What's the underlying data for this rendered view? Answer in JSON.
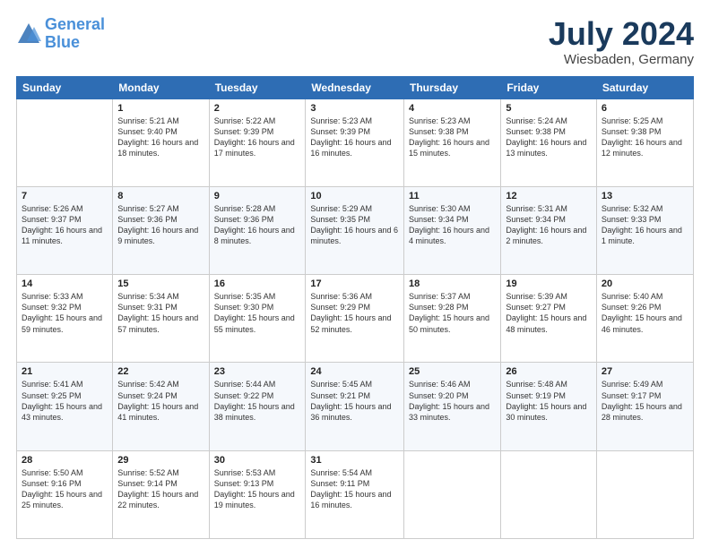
{
  "logo": {
    "line1": "General",
    "line2": "Blue"
  },
  "title": "July 2024",
  "location": "Wiesbaden, Germany",
  "headers": [
    "Sunday",
    "Monday",
    "Tuesday",
    "Wednesday",
    "Thursday",
    "Friday",
    "Saturday"
  ],
  "weeks": [
    [
      {
        "date": "",
        "sunrise": "",
        "sunset": "",
        "daylight": ""
      },
      {
        "date": "1",
        "sunrise": "Sunrise: 5:21 AM",
        "sunset": "Sunset: 9:40 PM",
        "daylight": "Daylight: 16 hours and 18 minutes."
      },
      {
        "date": "2",
        "sunrise": "Sunrise: 5:22 AM",
        "sunset": "Sunset: 9:39 PM",
        "daylight": "Daylight: 16 hours and 17 minutes."
      },
      {
        "date": "3",
        "sunrise": "Sunrise: 5:23 AM",
        "sunset": "Sunset: 9:39 PM",
        "daylight": "Daylight: 16 hours and 16 minutes."
      },
      {
        "date": "4",
        "sunrise": "Sunrise: 5:23 AM",
        "sunset": "Sunset: 9:38 PM",
        "daylight": "Daylight: 16 hours and 15 minutes."
      },
      {
        "date": "5",
        "sunrise": "Sunrise: 5:24 AM",
        "sunset": "Sunset: 9:38 PM",
        "daylight": "Daylight: 16 hours and 13 minutes."
      },
      {
        "date": "6",
        "sunrise": "Sunrise: 5:25 AM",
        "sunset": "Sunset: 9:38 PM",
        "daylight": "Daylight: 16 hours and 12 minutes."
      }
    ],
    [
      {
        "date": "7",
        "sunrise": "Sunrise: 5:26 AM",
        "sunset": "Sunset: 9:37 PM",
        "daylight": "Daylight: 16 hours and 11 minutes."
      },
      {
        "date": "8",
        "sunrise": "Sunrise: 5:27 AM",
        "sunset": "Sunset: 9:36 PM",
        "daylight": "Daylight: 16 hours and 9 minutes."
      },
      {
        "date": "9",
        "sunrise": "Sunrise: 5:28 AM",
        "sunset": "Sunset: 9:36 PM",
        "daylight": "Daylight: 16 hours and 8 minutes."
      },
      {
        "date": "10",
        "sunrise": "Sunrise: 5:29 AM",
        "sunset": "Sunset: 9:35 PM",
        "daylight": "Daylight: 16 hours and 6 minutes."
      },
      {
        "date": "11",
        "sunrise": "Sunrise: 5:30 AM",
        "sunset": "Sunset: 9:34 PM",
        "daylight": "Daylight: 16 hours and 4 minutes."
      },
      {
        "date": "12",
        "sunrise": "Sunrise: 5:31 AM",
        "sunset": "Sunset: 9:34 PM",
        "daylight": "Daylight: 16 hours and 2 minutes."
      },
      {
        "date": "13",
        "sunrise": "Sunrise: 5:32 AM",
        "sunset": "Sunset: 9:33 PM",
        "daylight": "Daylight: 16 hours and 1 minute."
      }
    ],
    [
      {
        "date": "14",
        "sunrise": "Sunrise: 5:33 AM",
        "sunset": "Sunset: 9:32 PM",
        "daylight": "Daylight: 15 hours and 59 minutes."
      },
      {
        "date": "15",
        "sunrise": "Sunrise: 5:34 AM",
        "sunset": "Sunset: 9:31 PM",
        "daylight": "Daylight: 15 hours and 57 minutes."
      },
      {
        "date": "16",
        "sunrise": "Sunrise: 5:35 AM",
        "sunset": "Sunset: 9:30 PM",
        "daylight": "Daylight: 15 hours and 55 minutes."
      },
      {
        "date": "17",
        "sunrise": "Sunrise: 5:36 AM",
        "sunset": "Sunset: 9:29 PM",
        "daylight": "Daylight: 15 hours and 52 minutes."
      },
      {
        "date": "18",
        "sunrise": "Sunrise: 5:37 AM",
        "sunset": "Sunset: 9:28 PM",
        "daylight": "Daylight: 15 hours and 50 minutes."
      },
      {
        "date": "19",
        "sunrise": "Sunrise: 5:39 AM",
        "sunset": "Sunset: 9:27 PM",
        "daylight": "Daylight: 15 hours and 48 minutes."
      },
      {
        "date": "20",
        "sunrise": "Sunrise: 5:40 AM",
        "sunset": "Sunset: 9:26 PM",
        "daylight": "Daylight: 15 hours and 46 minutes."
      }
    ],
    [
      {
        "date": "21",
        "sunrise": "Sunrise: 5:41 AM",
        "sunset": "Sunset: 9:25 PM",
        "daylight": "Daylight: 15 hours and 43 minutes."
      },
      {
        "date": "22",
        "sunrise": "Sunrise: 5:42 AM",
        "sunset": "Sunset: 9:24 PM",
        "daylight": "Daylight: 15 hours and 41 minutes."
      },
      {
        "date": "23",
        "sunrise": "Sunrise: 5:44 AM",
        "sunset": "Sunset: 9:22 PM",
        "daylight": "Daylight: 15 hours and 38 minutes."
      },
      {
        "date": "24",
        "sunrise": "Sunrise: 5:45 AM",
        "sunset": "Sunset: 9:21 PM",
        "daylight": "Daylight: 15 hours and 36 minutes."
      },
      {
        "date": "25",
        "sunrise": "Sunrise: 5:46 AM",
        "sunset": "Sunset: 9:20 PM",
        "daylight": "Daylight: 15 hours and 33 minutes."
      },
      {
        "date": "26",
        "sunrise": "Sunrise: 5:48 AM",
        "sunset": "Sunset: 9:19 PM",
        "daylight": "Daylight: 15 hours and 30 minutes."
      },
      {
        "date": "27",
        "sunrise": "Sunrise: 5:49 AM",
        "sunset": "Sunset: 9:17 PM",
        "daylight": "Daylight: 15 hours and 28 minutes."
      }
    ],
    [
      {
        "date": "28",
        "sunrise": "Sunrise: 5:50 AM",
        "sunset": "Sunset: 9:16 PM",
        "daylight": "Daylight: 15 hours and 25 minutes."
      },
      {
        "date": "29",
        "sunrise": "Sunrise: 5:52 AM",
        "sunset": "Sunset: 9:14 PM",
        "daylight": "Daylight: 15 hours and 22 minutes."
      },
      {
        "date": "30",
        "sunrise": "Sunrise: 5:53 AM",
        "sunset": "Sunset: 9:13 PM",
        "daylight": "Daylight: 15 hours and 19 minutes."
      },
      {
        "date": "31",
        "sunrise": "Sunrise: 5:54 AM",
        "sunset": "Sunset: 9:11 PM",
        "daylight": "Daylight: 15 hours and 16 minutes."
      },
      {
        "date": "",
        "sunrise": "",
        "sunset": "",
        "daylight": ""
      },
      {
        "date": "",
        "sunrise": "",
        "sunset": "",
        "daylight": ""
      },
      {
        "date": "",
        "sunrise": "",
        "sunset": "",
        "daylight": ""
      }
    ]
  ]
}
